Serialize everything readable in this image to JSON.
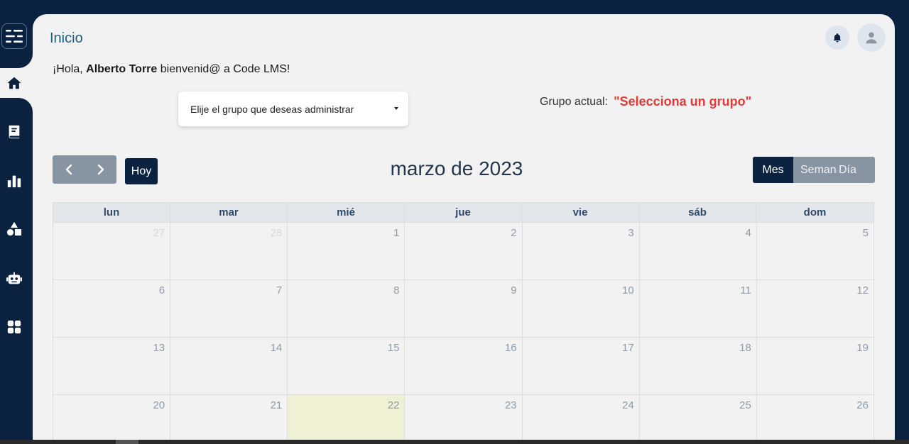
{
  "header": {
    "title": "Inicio",
    "bell_icon": "bell-icon",
    "avatar_icon": "user-icon"
  },
  "sidebar": {
    "items": [
      {
        "icon": "menu-icon",
        "active": false
      },
      {
        "icon": "home-icon",
        "active": true
      },
      {
        "icon": "book-icon",
        "active": false
      },
      {
        "icon": "bar-chart-icon",
        "active": false
      },
      {
        "icon": "shapes-icon",
        "active": false
      },
      {
        "icon": "robot-icon",
        "active": false
      },
      {
        "icon": "grid-icon",
        "active": false
      }
    ]
  },
  "greeting": {
    "prefix": "¡Hola,",
    "user_name": "Alberto Torre",
    "suffix": "bienvenid@ a Code LMS!"
  },
  "group_select": {
    "label": "Elije el grupo que deseas administrar"
  },
  "current_group": {
    "label": "Grupo actual:",
    "value": "\"Selecciona un grupo\""
  },
  "calendar": {
    "today_label": "Hoy",
    "title": "marzo de 2023",
    "views": {
      "month": "Mes",
      "week": "Semana",
      "day": "Día"
    },
    "weekdays": [
      "lun",
      "mar",
      "mié",
      "jue",
      "vie",
      "sáb",
      "dom"
    ],
    "weeks": [
      [
        {
          "d": "27",
          "other": true
        },
        {
          "d": "28",
          "other": true
        },
        {
          "d": "1"
        },
        {
          "d": "2"
        },
        {
          "d": "3"
        },
        {
          "d": "4"
        },
        {
          "d": "5"
        }
      ],
      [
        {
          "d": "6"
        },
        {
          "d": "7"
        },
        {
          "d": "8"
        },
        {
          "d": "9"
        },
        {
          "d": "10"
        },
        {
          "d": "11"
        },
        {
          "d": "12"
        }
      ],
      [
        {
          "d": "13"
        },
        {
          "d": "14"
        },
        {
          "d": "15"
        },
        {
          "d": "16"
        },
        {
          "d": "17"
        },
        {
          "d": "18"
        },
        {
          "d": "19"
        }
      ],
      [
        {
          "d": "20"
        },
        {
          "d": "21"
        },
        {
          "d": "22",
          "today": true
        },
        {
          "d": "23"
        },
        {
          "d": "24"
        },
        {
          "d": "25"
        },
        {
          "d": "26"
        }
      ]
    ]
  },
  "colors": {
    "sidebar_bg": "#0a2240",
    "accent_title": "#1e5f86",
    "alert_red": "#e53935",
    "today_bg": "#eff0d4"
  }
}
